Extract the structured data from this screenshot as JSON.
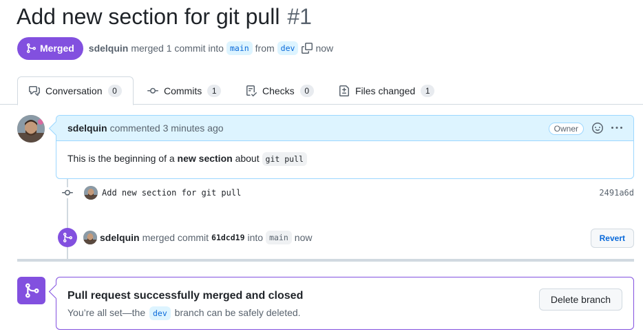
{
  "pr": {
    "title": "Add new section for git pull",
    "number": "#1",
    "state_label": "Merged",
    "author": "sdelquin",
    "merged_text": "merged 1 commit into",
    "base_branch": "main",
    "from_text": "from",
    "head_branch": "dev",
    "time": "now"
  },
  "tabs": [
    {
      "label": "Conversation",
      "count": "0"
    },
    {
      "label": "Commits",
      "count": "1"
    },
    {
      "label": "Checks",
      "count": "0"
    },
    {
      "label": "Files changed",
      "count": "1"
    }
  ],
  "comment": {
    "author": "sdelquin",
    "action": "commented 3 minutes ago",
    "role_badge": "Owner",
    "body_prefix": "This is the beginning of a ",
    "body_bold": "new section",
    "body_mid": " about ",
    "body_code": "git pull"
  },
  "commit": {
    "message": "Add new section for git pull",
    "sha": "2491a6d"
  },
  "merge_event": {
    "author": "sdelquin",
    "action": "merged commit",
    "sha": "61dcd19",
    "into_text": "into",
    "branch": "main",
    "time": "now",
    "revert_label": "Revert"
  },
  "merged_status": {
    "title": "Pull request successfully merged and closed",
    "desc_prefix": "You’re all set—the",
    "branch": "dev",
    "desc_suffix": "branch can be safely deleted.",
    "delete_label": "Delete branch"
  },
  "colors": {
    "merged_purple": "#8250df",
    "link_blue": "#0969da",
    "comment_header_bg": "#ddf4ff"
  },
  "icons": [
    "git-merge-icon",
    "copy-icon",
    "comment-discussion-icon",
    "git-commit-icon",
    "checklist-icon",
    "file-diff-icon",
    "smiley-icon",
    "kebab-horizontal-icon"
  ]
}
